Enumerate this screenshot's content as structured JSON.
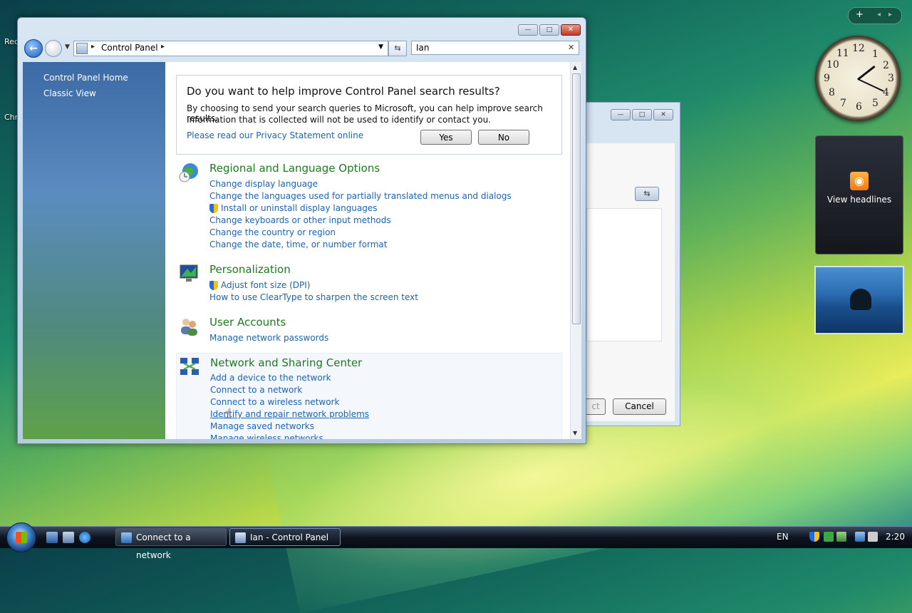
{
  "desktop": {
    "icon_labels": [
      "Rec",
      "Chr"
    ]
  },
  "gadgets": {
    "top_add": "+",
    "top_prev": "◂",
    "top_next": "▸",
    "clock_numbers": [
      "12",
      "1",
      "2",
      "3",
      "4",
      "5",
      "6",
      "7",
      "8",
      "9",
      "10",
      "11"
    ],
    "feed_label": "View headlines"
  },
  "background_window": {
    "next_partial": "ct",
    "cancel_label": "Cancel"
  },
  "window": {
    "minimize": "—",
    "maximize": "□",
    "close": "✕",
    "address": {
      "crumb": "Control Panel",
      "separator": "▸"
    },
    "search": {
      "value": "Ian",
      "clear": "✕"
    },
    "left_pane": {
      "links": [
        "Control Panel Home",
        "Classic View"
      ]
    },
    "prompt": {
      "title": "Do you want to help improve Control Panel search results?",
      "line1": "By choosing to send your search queries to Microsoft, you can help improve search results.",
      "line2": "Information that is collected will not be used to identify or contact you.",
      "privacy_link": "Please read our Privacy Statement online",
      "yes_label": "Yes",
      "no_label": "No"
    },
    "categories": [
      {
        "title": "Regional and Language Options",
        "icon": "globe-clock-icon",
        "links": [
          {
            "text": "Change display language",
            "shield": false
          },
          {
            "text": "Change the languages used for partially translated menus and dialogs",
            "shield": false
          },
          {
            "text": "Install or uninstall display languages",
            "shield": true
          },
          {
            "text": "Change keyboards or other input methods",
            "shield": false
          },
          {
            "text": "Change the country or region",
            "shield": false
          },
          {
            "text": "Change the date, time, or number format",
            "shield": false
          }
        ]
      },
      {
        "title": "Personalization",
        "icon": "monitor-icon",
        "links": [
          {
            "text": "Adjust font size (DPI)",
            "shield": true
          },
          {
            "text": "How to use ClearType to sharpen the screen text",
            "shield": false
          }
        ]
      },
      {
        "title": "User Accounts",
        "icon": "users-icon",
        "links": [
          {
            "text": "Manage network passwords",
            "shield": false
          }
        ]
      },
      {
        "title": "Network and Sharing Center",
        "icon": "network-icon",
        "links": [
          {
            "text": "Add a device to the network",
            "shield": false
          },
          {
            "text": "Connect to a network",
            "shield": false
          },
          {
            "text": "Connect to a wireless network",
            "shield": false
          },
          {
            "text": "Identify and repair network problems",
            "shield": false
          },
          {
            "text": "Manage saved networks",
            "shield": false
          },
          {
            "text": "Manage wireless networks",
            "shield": false
          }
        ]
      }
    ]
  },
  "taskbar": {
    "tasks": [
      "Connect to a network",
      "Ian - Control Panel"
    ],
    "language": "EN",
    "time": "2:20"
  },
  "colors": {
    "link": "#1c62b5",
    "category_title": "#1d7a1d"
  }
}
